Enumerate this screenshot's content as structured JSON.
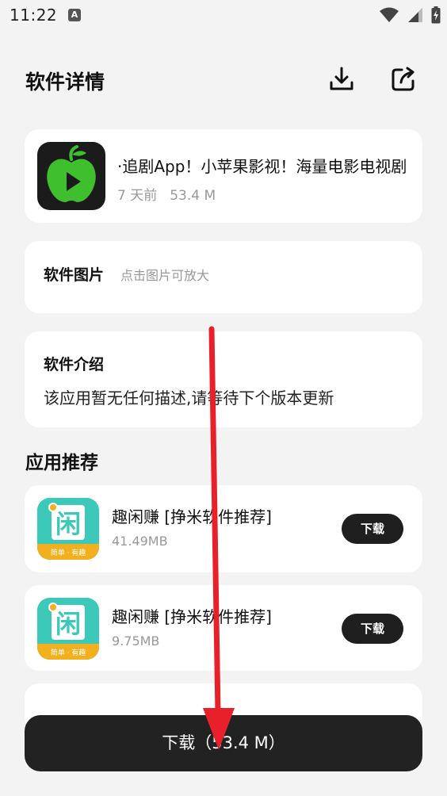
{
  "status_bar": {
    "time": "11:22",
    "notification_letter": "A",
    "icons": [
      "wifi-icon",
      "signal-icon",
      "battery-icon"
    ]
  },
  "header": {
    "title": "软件详情",
    "actions": [
      "download-icon",
      "share-icon"
    ]
  },
  "app": {
    "name": "·追剧App！小苹果影视！海量电影电视剧",
    "updated": "7 天前",
    "size": "53.4 M",
    "icon": "green-apple-play-icon"
  },
  "screenshots_section": {
    "label": "软件图片",
    "hint": "点击图片可放大"
  },
  "intro_section": {
    "label": "软件介绍",
    "text": "该应用暂无任何描述,请等待下个版本更新"
  },
  "recommend": {
    "title": "应用推荐",
    "items": [
      {
        "name": "趣闲赚 [挣米软件推荐]",
        "size": "41.49MB",
        "button": "下载",
        "icon_text": "闲",
        "icon_caption": "简单 · 有趣"
      },
      {
        "name": "趣闲赚 [挣米软件推荐]",
        "size": "9.75MB",
        "button": "下载",
        "icon_text": "闲",
        "icon_caption": "简单 · 有趣"
      }
    ]
  },
  "download_button": {
    "label": "下载（53.4 M）"
  },
  "colors": {
    "background": "#f3f3f3",
    "card": "#ffffff",
    "dark_button": "#222222",
    "accent_green": "#3fbf2e",
    "rec_icon_teal": "#3cc9b9",
    "annotation_arrow": "#e8202a"
  }
}
